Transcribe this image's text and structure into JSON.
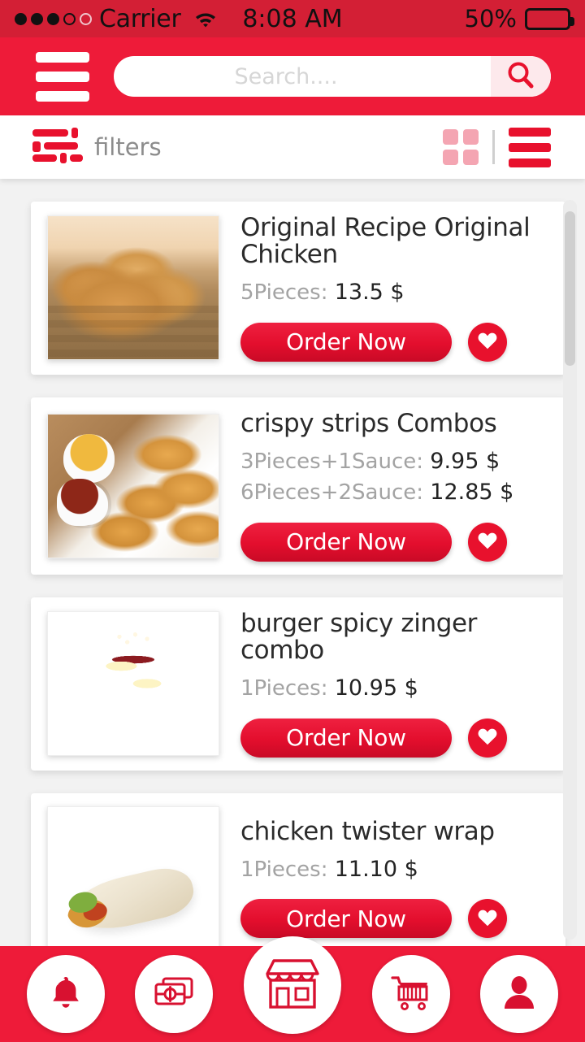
{
  "status_bar": {
    "carrier": "Carrier",
    "time": "8:08 AM",
    "battery_percent": "50%",
    "signal_dots_filled": 3,
    "signal_dots_total": 5,
    "wifi_icon": "wifi-icon",
    "battery_icon": "battery-icon",
    "battery_level": 50
  },
  "header": {
    "menu_icon": "hamburger-menu-icon",
    "search": {
      "placeholder": "Search....",
      "value": "",
      "icon": "search-icon"
    },
    "background_color": "#ee1b39"
  },
  "filter_bar": {
    "filters_label": "filters",
    "filters_icon": "sliders-filter-icon",
    "grid_view_icon": "grid-view-icon",
    "list_view_icon": "list-view-icon",
    "active_view": "list",
    "grid_color": "#f4a5b2",
    "list_color": "#e8112d"
  },
  "products": [
    {
      "title": "Original Recipe Original Chicken",
      "image": "fried-chicken-bucket-pieces",
      "image_class": "img-chicken",
      "prices": [
        {
          "label": "5Pieces:",
          "value": "13.5 $"
        }
      ],
      "order_label": "Order Now",
      "favorite_icon": "heart-icon"
    },
    {
      "title": "crispy strips Combos",
      "image": "crispy-chicken-strips-with-sauces",
      "image_class": "img-strips",
      "prices": [
        {
          "label": "3Pieces+1Sauce:",
          "value": "9.95 $"
        },
        {
          "label": "6Pieces+2Sauce:",
          "value": "12.85 $"
        }
      ],
      "order_label": "Order Now",
      "favorite_icon": "heart-icon"
    },
    {
      "title": "burger spicy zinger combo",
      "image": "double-stacked-zinger-burger",
      "image_class": "img-burger",
      "prices": [
        {
          "label": "1Pieces:",
          "value": "10.95 $"
        }
      ],
      "order_label": "Order Now",
      "favorite_icon": "heart-icon"
    },
    {
      "title": "chicken twister wrap",
      "image": "chicken-tortilla-wrap",
      "image_class": "img-wrap-food",
      "prices": [
        {
          "label": "1Pieces:",
          "value": "11.10 $"
        }
      ],
      "order_label": "Order Now",
      "favorite_icon": "heart-icon"
    }
  ],
  "bottom_nav": [
    {
      "name": "notifications",
      "icon": "bell-icon"
    },
    {
      "name": "payments",
      "icon": "money-cash-icon"
    },
    {
      "name": "store",
      "icon": "store-shop-icon"
    },
    {
      "name": "cart",
      "icon": "shopping-cart-icon"
    },
    {
      "name": "profile",
      "icon": "user-profile-icon"
    }
  ],
  "theme": {
    "primary_red": "#ee1b39",
    "status_red": "#d31f35",
    "button_red": "#e30e2d",
    "page_background": "#f2f2f2"
  }
}
